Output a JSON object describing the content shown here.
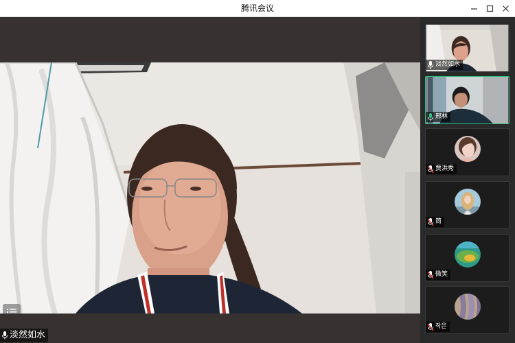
{
  "window": {
    "title": "腾讯会议"
  },
  "main": {
    "speaker_name": "淡然如水",
    "mic_state": "on"
  },
  "participants": [
    {
      "name": "淡然如水",
      "mic": "on",
      "type": "camera",
      "active": false
    },
    {
      "name": "邢林",
      "mic": "on-green",
      "type": "camera",
      "active": true
    },
    {
      "name": "贾洪秀",
      "mic": "muted",
      "type": "avatar",
      "active": false
    },
    {
      "name": "简",
      "mic": "muted",
      "type": "avatar",
      "active": false
    },
    {
      "name": "微笑",
      "mic": "muted",
      "type": "avatar",
      "active": false
    },
    {
      "name": "작은",
      "mic": "muted",
      "type": "avatar",
      "active": false
    }
  ],
  "colors": {
    "active_border": "#2ec27e",
    "muted_icon": "#e04343",
    "background": "#2b2b2b"
  },
  "icons": {
    "minimize": "minimize-icon",
    "maximize": "maximize-icon",
    "close": "close-icon",
    "mic": "microphone-icon",
    "mic_muted": "microphone-muted-icon",
    "member_list": "list-icon"
  }
}
